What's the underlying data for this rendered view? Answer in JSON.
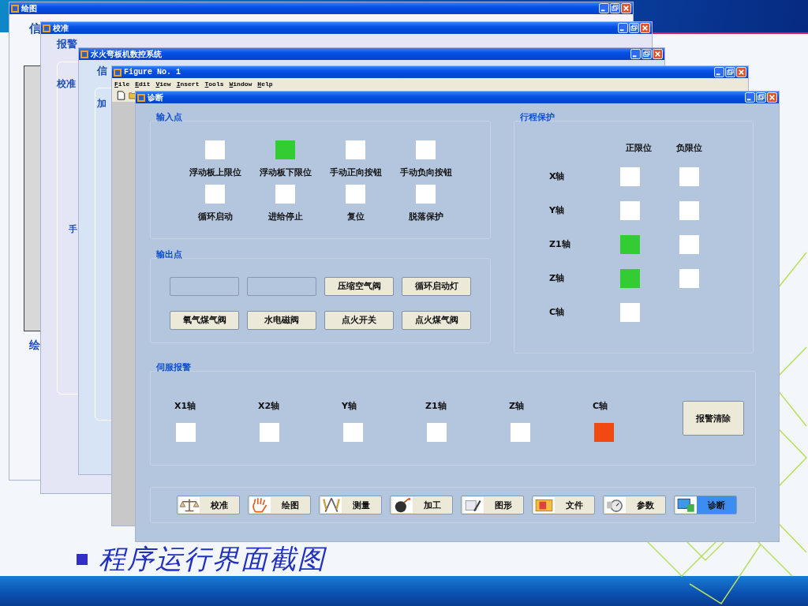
{
  "slide": {
    "caption": "程序运行界面截图"
  },
  "back_windows": [
    {
      "kind": "drawing",
      "title": "绘图",
      "texts": [
        "信",
        "绘"
      ]
    },
    {
      "kind": "calibration",
      "title": "校准",
      "texts": [
        "报警",
        "校准",
        "手"
      ]
    },
    {
      "kind": "control",
      "title": "水火弯板机数控系统",
      "texts": [
        "信",
        "加"
      ]
    },
    {
      "kind": "figure",
      "title": "Figure No. 1",
      "menu": [
        "File",
        "Edit",
        "View",
        "Insert",
        "Tools",
        "Window",
        "Help"
      ]
    }
  ],
  "diagnosis": {
    "title": "诊断",
    "input_points": {
      "title": "输入点",
      "items": [
        {
          "label": "浮动板上限位",
          "on": false
        },
        {
          "label": "浮动板下限位",
          "on": true
        },
        {
          "label": "手动正向按钮",
          "on": false
        },
        {
          "label": "手动负向按钮",
          "on": false
        },
        {
          "label": "循环启动",
          "on": false
        },
        {
          "label": "进给停止",
          "on": false
        },
        {
          "label": "复位",
          "on": false
        },
        {
          "label": "脱落保护",
          "on": false
        }
      ]
    },
    "output_points": {
      "title": "输出点",
      "buttons": [
        {
          "kind": "blank"
        },
        {
          "kind": "blank"
        },
        {
          "kind": "button",
          "label": "压缩空气阀"
        },
        {
          "kind": "button",
          "label": "循环启动灯"
        },
        {
          "kind": "button",
          "label": "氧气煤气阀"
        },
        {
          "kind": "button",
          "label": "水电磁阀"
        },
        {
          "kind": "button",
          "label": "点火开关"
        },
        {
          "kind": "button",
          "label": "点火煤气阀"
        }
      ]
    },
    "travel_protection": {
      "title": "行程保护",
      "columns": [
        "正限位",
        "负限位"
      ],
      "rows": [
        {
          "axis": "X轴",
          "positive": {
            "on": false
          },
          "negative": {
            "on": false
          }
        },
        {
          "axis": "Y轴",
          "positive": {
            "on": false
          },
          "negative": {
            "on": false
          }
        },
        {
          "axis": "Z1轴",
          "positive": {
            "on": true
          },
          "negative": {
            "on": false
          }
        },
        {
          "axis": "Z轴",
          "positive": {
            "on": true
          },
          "negative": {
            "on": false
          }
        },
        {
          "axis": "C轴",
          "positive": {
            "on": false
          }
        }
      ]
    },
    "servo_alarm": {
      "title": "伺服报警",
      "axes": [
        {
          "label": "X1轴",
          "alarm": false
        },
        {
          "label": "X2轴",
          "alarm": false
        },
        {
          "label": "Y轴",
          "alarm": false
        },
        {
          "label": "Z1轴",
          "alarm": false
        },
        {
          "label": "Z轴",
          "alarm": false
        },
        {
          "label": "C轴",
          "alarm": true
        }
      ],
      "clear_button": "报警清除"
    },
    "nav": [
      {
        "label": "校准",
        "selected": false
      },
      {
        "label": "绘图",
        "selected": false
      },
      {
        "label": "测量",
        "selected": false
      },
      {
        "label": "加工",
        "selected": false
      },
      {
        "label": "图形",
        "selected": false
      },
      {
        "label": "文件",
        "selected": false
      },
      {
        "label": "参数",
        "selected": false
      },
      {
        "label": "诊断",
        "selected": true
      }
    ]
  }
}
